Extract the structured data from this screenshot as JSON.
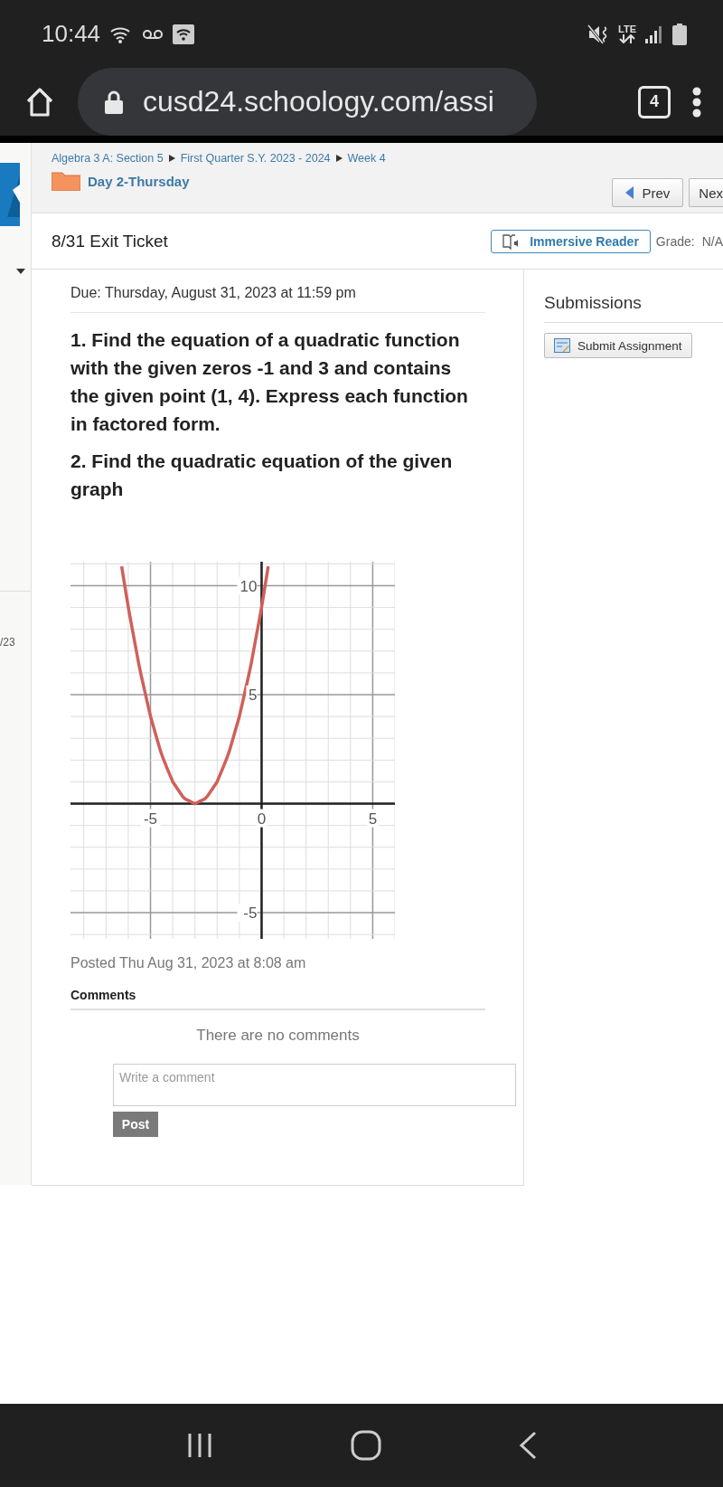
{
  "status_bar": {
    "time": "10:44",
    "network": "LTE"
  },
  "browser": {
    "url": "cusd24.schoology.com/assi",
    "tab_count": "4"
  },
  "sidebar": {
    "text": "/23"
  },
  "header": {
    "breadcrumbs": [
      "Algebra 3 A: Section 5",
      "First Quarter S.Y. 2023 - 2024",
      "Week 4"
    ],
    "folder": "Day 2-Thursday",
    "buttons": [
      {
        "label": "Prev",
        "kind": "prev"
      },
      {
        "label": "Nex",
        "kind": "next"
      }
    ]
  },
  "assignment": {
    "title": "8/31 Exit Ticket",
    "immersive_reader": "Immersive Reader",
    "grade_label": "Grade:",
    "grade": "N/A",
    "due": "Due: Thursday, August 31, 2023 at 11:59 pm",
    "questions": [
      "1. Find the equation of a quadratic function with the given zeros -1 and 3 and contains the given point (1, 4). Express each function in factored form.",
      "2.  Find the quadratic equation of the given graph"
    ],
    "chart_data": {
      "type": "line",
      "x": [
        -6.3,
        -6,
        -5.5,
        -5,
        -4.5,
        -4,
        -3.5,
        -3,
        -2.5,
        -2,
        -1.5,
        -1,
        -0.5,
        0,
        0.3
      ],
      "series": [
        {
          "color": "#d0605a",
          "values": [
            10.89,
            9,
            6.25,
            4,
            2.25,
            1,
            0.25,
            0,
            0.25,
            1,
            2.25,
            4,
            6.25,
            9,
            10.89
          ]
        }
      ],
      "xlim": [
        -8.6,
        6
      ],
      "ylim": [
        -6.2,
        11.1
      ],
      "xticks": [
        -5,
        0,
        5
      ],
      "yticks": [
        -5,
        5,
        10
      ],
      "grid": true
    },
    "posted": "Posted Thu Aug 31, 2023 at 8:08 am",
    "comments_heading": "Comments",
    "no_comments": "There are no comments",
    "comment_placeholder": "Write a comment",
    "post_button": "Post"
  },
  "submissions": {
    "title": "Submissions",
    "button": "Submit Assignment"
  }
}
